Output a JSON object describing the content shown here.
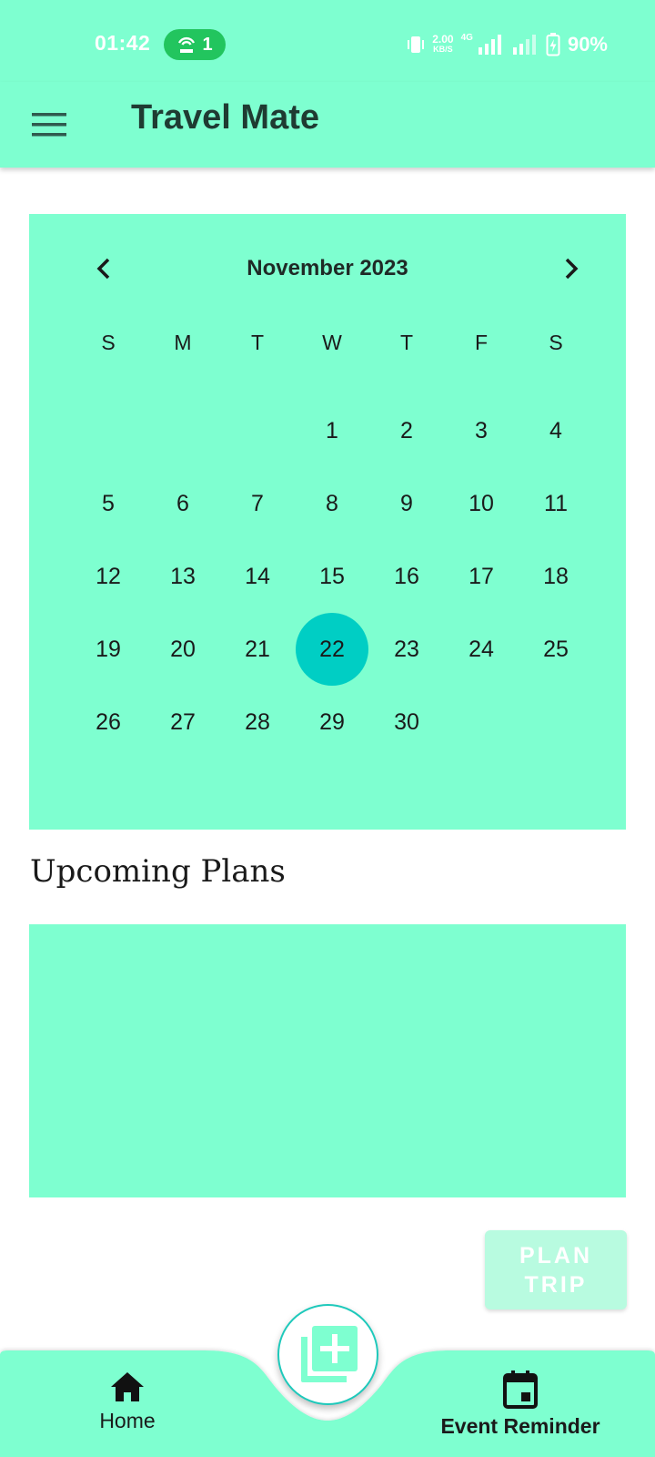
{
  "status_bar": {
    "time": "01:42",
    "hotspot_count": "1",
    "speed_value": "2.00",
    "speed_unit": "KB/S",
    "network_type": "4G",
    "battery": "90%"
  },
  "toolbar": {
    "title": "Travel Mate",
    "menu_icon": "hamburger-menu-icon"
  },
  "calendar": {
    "month_label": "November 2023",
    "prev_icon": "chevron-left-icon",
    "next_icon": "chevron-right-icon",
    "weekdays": [
      "S",
      "M",
      "T",
      "W",
      "T",
      "F",
      "S"
    ],
    "leading_blanks": 3,
    "days": [
      "1",
      "2",
      "3",
      "4",
      "5",
      "6",
      "7",
      "8",
      "9",
      "10",
      "11",
      "12",
      "13",
      "14",
      "15",
      "16",
      "17",
      "18",
      "19",
      "20",
      "21",
      "22",
      "23",
      "24",
      "25",
      "26",
      "27",
      "28",
      "29",
      "30"
    ],
    "selected_day": "22",
    "background_color": "#7effd0",
    "selected_color": "#00cec4"
  },
  "upcoming": {
    "title": "Upcoming Plans"
  },
  "plan_trip_button": {
    "line1": "PLAN",
    "line2": "TRIP"
  },
  "bottom_nav": {
    "home_label": "Home",
    "home_icon": "home-icon",
    "event_label": "Event Reminder",
    "event_icon": "calendar-event-icon",
    "fab_icon": "add-library-icon"
  },
  "colors": {
    "primary": "#7effd0",
    "accent": "#00cec4",
    "text_dark": "#1f3b32"
  }
}
